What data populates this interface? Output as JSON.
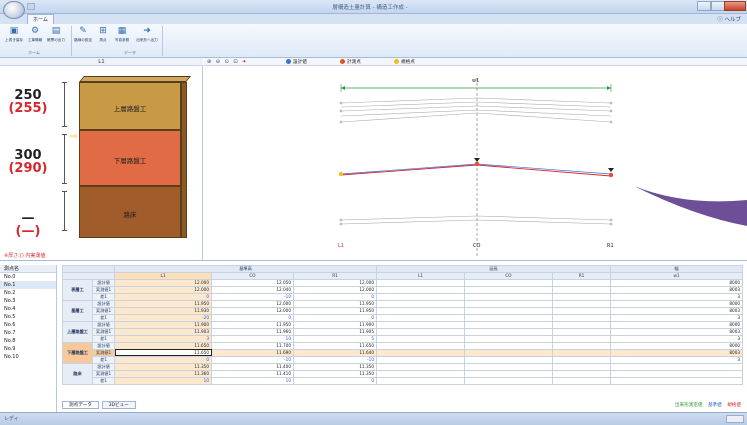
{
  "window": {
    "title": "層構造土量計算 - 構造工作成 -",
    "tab_home": "ホーム",
    "help": "ヘルプ"
  },
  "ribbon": {
    "buttons": [
      {
        "label": "上書き保存",
        "icon": "save-icon"
      },
      {
        "label": "工事情報",
        "icon": "project-info-icon"
      },
      {
        "label": "帳票の出力",
        "icon": "report-icon"
      },
      {
        "label": "路線の設定",
        "icon": "route-icon"
      },
      {
        "label": "測点",
        "icon": "station-icon"
      },
      {
        "label": "写真参照",
        "icon": "photo-icon"
      },
      {
        "label": "出来形へ出力",
        "icon": "export-icon"
      }
    ],
    "group_home": "ホーム",
    "group_data": "データ"
  },
  "left_diagram": {
    "header": "L1",
    "layers": [
      {
        "name": "上層路盤工",
        "design": "250",
        "actual": "(255)"
      },
      {
        "name": "下層路盤工",
        "design": "300",
        "actual": "(290)"
      },
      {
        "name": "路床",
        "design": "—",
        "actual": "(—)"
      }
    ],
    "note": "※厚さ:() 内実測値"
  },
  "graph": {
    "toolbar_icons": [
      "zoom-in-icon",
      "zoom-out-icon",
      "zoom-fit-icon",
      "pan-icon",
      "pin-icon"
    ],
    "legend": [
      {
        "label": "設計値",
        "color": "#3b6fd0"
      },
      {
        "label": "計測点",
        "color": "#e0502a"
      },
      {
        "label": "規格点",
        "color": "#f0c020"
      }
    ],
    "width_label": "w1",
    "point_labels": [
      "L1",
      "CO",
      "R1"
    ]
  },
  "station_list": {
    "header": "測点名",
    "items": [
      "No.0",
      "No.1",
      "No.2",
      "No.3",
      "No.4",
      "No.5",
      "No.6",
      "No.7",
      "No.8",
      "No.9",
      "No.10"
    ],
    "selected": "No.1"
  },
  "table": {
    "group_headers": [
      "基準高",
      "延長",
      "幅"
    ],
    "columns": [
      "L1",
      "CO",
      "R1",
      "L1",
      "CO",
      "R1",
      "w1"
    ],
    "row_kinds": [
      "設計値",
      "実測値1",
      "差1"
    ],
    "sections": [
      {
        "name": "表層工",
        "rows": [
          [
            "設計値",
            "12.000",
            "12.050",
            "12.000",
            "8000"
          ],
          [
            "実測値1",
            "12.000",
            "12.040",
            "12.000",
            "8003"
          ],
          [
            "差1",
            "0",
            "-10",
            "0",
            "3"
          ]
        ]
      },
      {
        "name": "基層工",
        "rows": [
          [
            "設計値",
            "11.950",
            "12.000",
            "11.950",
            "8000"
          ],
          [
            "実測値1",
            "11.930",
            "12.000",
            "11.950",
            "8003"
          ],
          [
            "差1",
            "-20",
            "0",
            "0",
            "3"
          ]
        ]
      },
      {
        "name": "上層路盤工",
        "rows": [
          [
            "設計値",
            "11.900",
            "11.950",
            "11.900",
            "8000"
          ],
          [
            "実測値1",
            "11.903",
            "11.960",
            "11.905",
            "8003"
          ],
          [
            "差1",
            "3",
            "10",
            "5",
            "3"
          ]
        ]
      },
      {
        "name": "下層路盤工",
        "rows": [
          [
            "設計値",
            "11.650",
            "11.700",
            "11.650",
            "8000"
          ],
          [
            "実測値1",
            "11.650",
            "11.690",
            "11.640",
            "8003"
          ],
          [
            "差1",
            "0",
            "-10",
            "-10",
            "3"
          ]
        ]
      },
      {
        "name": "路床",
        "rows": [
          [
            "設計値",
            "11.350",
            "11.400",
            "11.350",
            ""
          ],
          [
            "実測値1",
            "11.360",
            "11.410",
            "11.350",
            ""
          ],
          [
            "差1",
            "10",
            "10",
            "0",
            ""
          ]
        ]
      }
    ]
  },
  "bottom_tabs": [
    "測点データ",
    "3Dビュー"
  ],
  "bottom_legend": [
    {
      "label": "出来形測定値",
      "color": "#2a9a2a"
    },
    {
      "label": "基準値",
      "color": "#2a5ad0"
    },
    {
      "label": "規格値",
      "color": "#d9262c"
    }
  ],
  "status": "レディ"
}
